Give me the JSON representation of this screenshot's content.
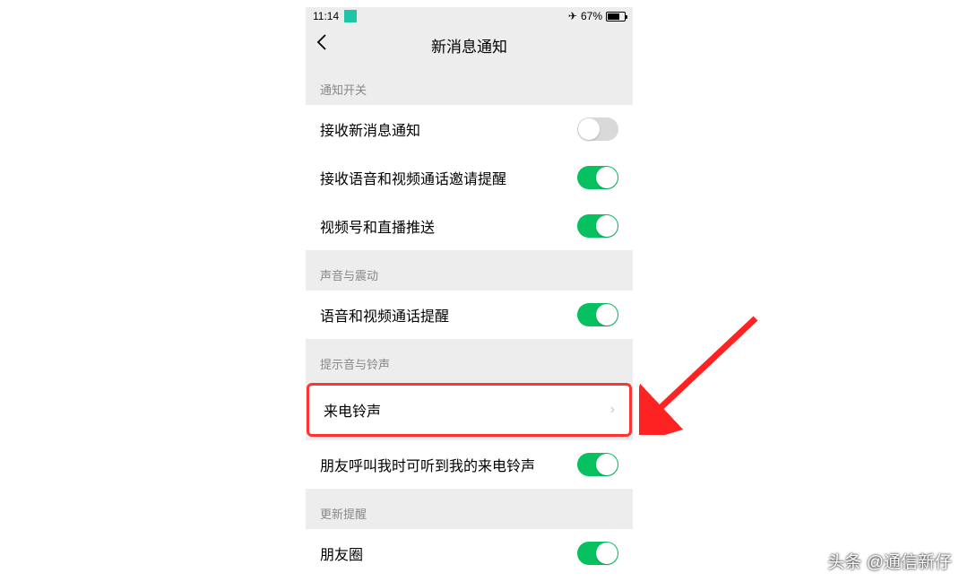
{
  "status": {
    "time": "11:14",
    "battery_pct": "67%"
  },
  "nav": {
    "title": "新消息通知"
  },
  "sections": {
    "notify_switch": {
      "title": "通知开关"
    },
    "sound_vibrate": {
      "title": "声音与震动"
    },
    "tone_ring": {
      "title": "提示音与铃声"
    },
    "update_reminder": {
      "title": "更新提醒"
    }
  },
  "items": {
    "receive_new_msg": {
      "label": "接收新消息通知",
      "on": false
    },
    "receive_voice_video": {
      "label": "接收语音和视频通话邀请提醒",
      "on": true
    },
    "channel_live": {
      "label": "视频号和直播推送",
      "on": true
    },
    "voice_video_alert": {
      "label": "语音和视频通话提醒",
      "on": true
    },
    "incoming_ringtone": {
      "label": "来电铃声"
    },
    "friend_ringtone": {
      "label": "朋友呼叫我时可听到我的来电铃声",
      "on": true
    },
    "moments": {
      "label": "朋友圈",
      "on": true
    }
  },
  "watermark": "头条 @通信新仔"
}
